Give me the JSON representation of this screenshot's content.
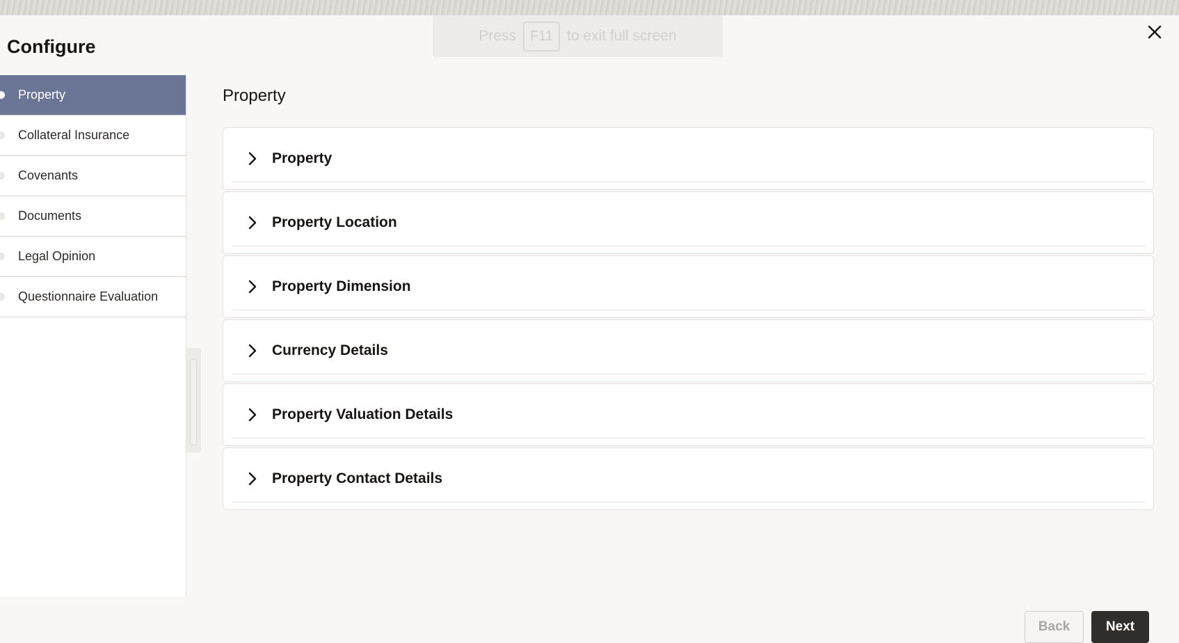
{
  "fullscreen_notice": {
    "press": "Press",
    "key": "F11",
    "rest": "to exit full screen"
  },
  "dialog": {
    "title": "Configure",
    "close_icon": "close-icon"
  },
  "sidebar": {
    "items": [
      {
        "label": "Property",
        "active": true
      },
      {
        "label": "Collateral Insurance",
        "active": false
      },
      {
        "label": "Covenants",
        "active": false
      },
      {
        "label": "Documents",
        "active": false
      },
      {
        "label": "Legal Opinion",
        "active": false
      },
      {
        "label": "Questionnaire Evaluation",
        "active": false
      }
    ]
  },
  "main": {
    "section_title": "Property",
    "accordions": [
      {
        "label": "Property",
        "icon": "chevron-right-icon"
      },
      {
        "label": "Property Location",
        "icon": "chevron-right-icon"
      },
      {
        "label": "Property Dimension",
        "icon": "chevron-right-icon"
      },
      {
        "label": "Currency Details",
        "icon": "chevron-right-icon"
      },
      {
        "label": "Property Valuation Details",
        "icon": "chevron-right-icon"
      },
      {
        "label": "Property Contact Details",
        "icon": "chevron-right-icon"
      }
    ]
  },
  "footer": {
    "back_label": "Back",
    "next_label": "Next"
  },
  "colors": {
    "active_nav_bg": "#6b7595",
    "next_button_bg": "#312d2a",
    "page_bg": "#f8f7f5"
  }
}
